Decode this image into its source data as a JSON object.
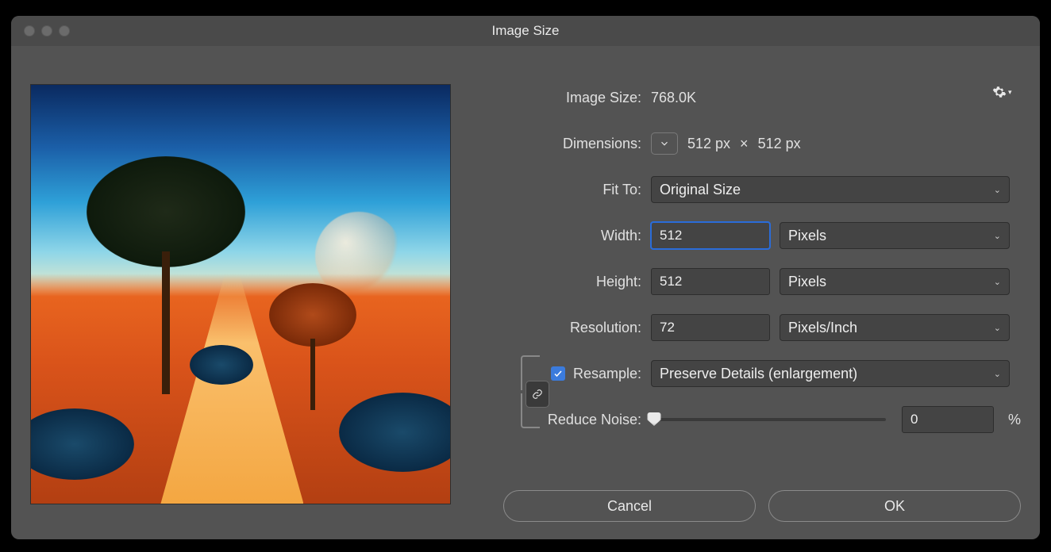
{
  "window": {
    "title": "Image Size"
  },
  "info": {
    "image_size_label": "Image Size:",
    "image_size_value": "768.0K",
    "dimensions_label": "Dimensions:",
    "dim_w": "512 px",
    "dim_sep": "×",
    "dim_h": "512 px"
  },
  "fit": {
    "label": "Fit To:",
    "value": "Original Size"
  },
  "width": {
    "label": "Width:",
    "value": "512",
    "unit": "Pixels"
  },
  "height": {
    "label": "Height:",
    "value": "512",
    "unit": "Pixels"
  },
  "resolution": {
    "label": "Resolution:",
    "value": "72",
    "unit": "Pixels/Inch"
  },
  "resample": {
    "label": "Resample:",
    "checked": true,
    "method": "Preserve Details (enlargement)"
  },
  "noise": {
    "label": "Reduce Noise:",
    "value": "0",
    "unit": "%"
  },
  "buttons": {
    "cancel": "Cancel",
    "ok": "OK"
  }
}
